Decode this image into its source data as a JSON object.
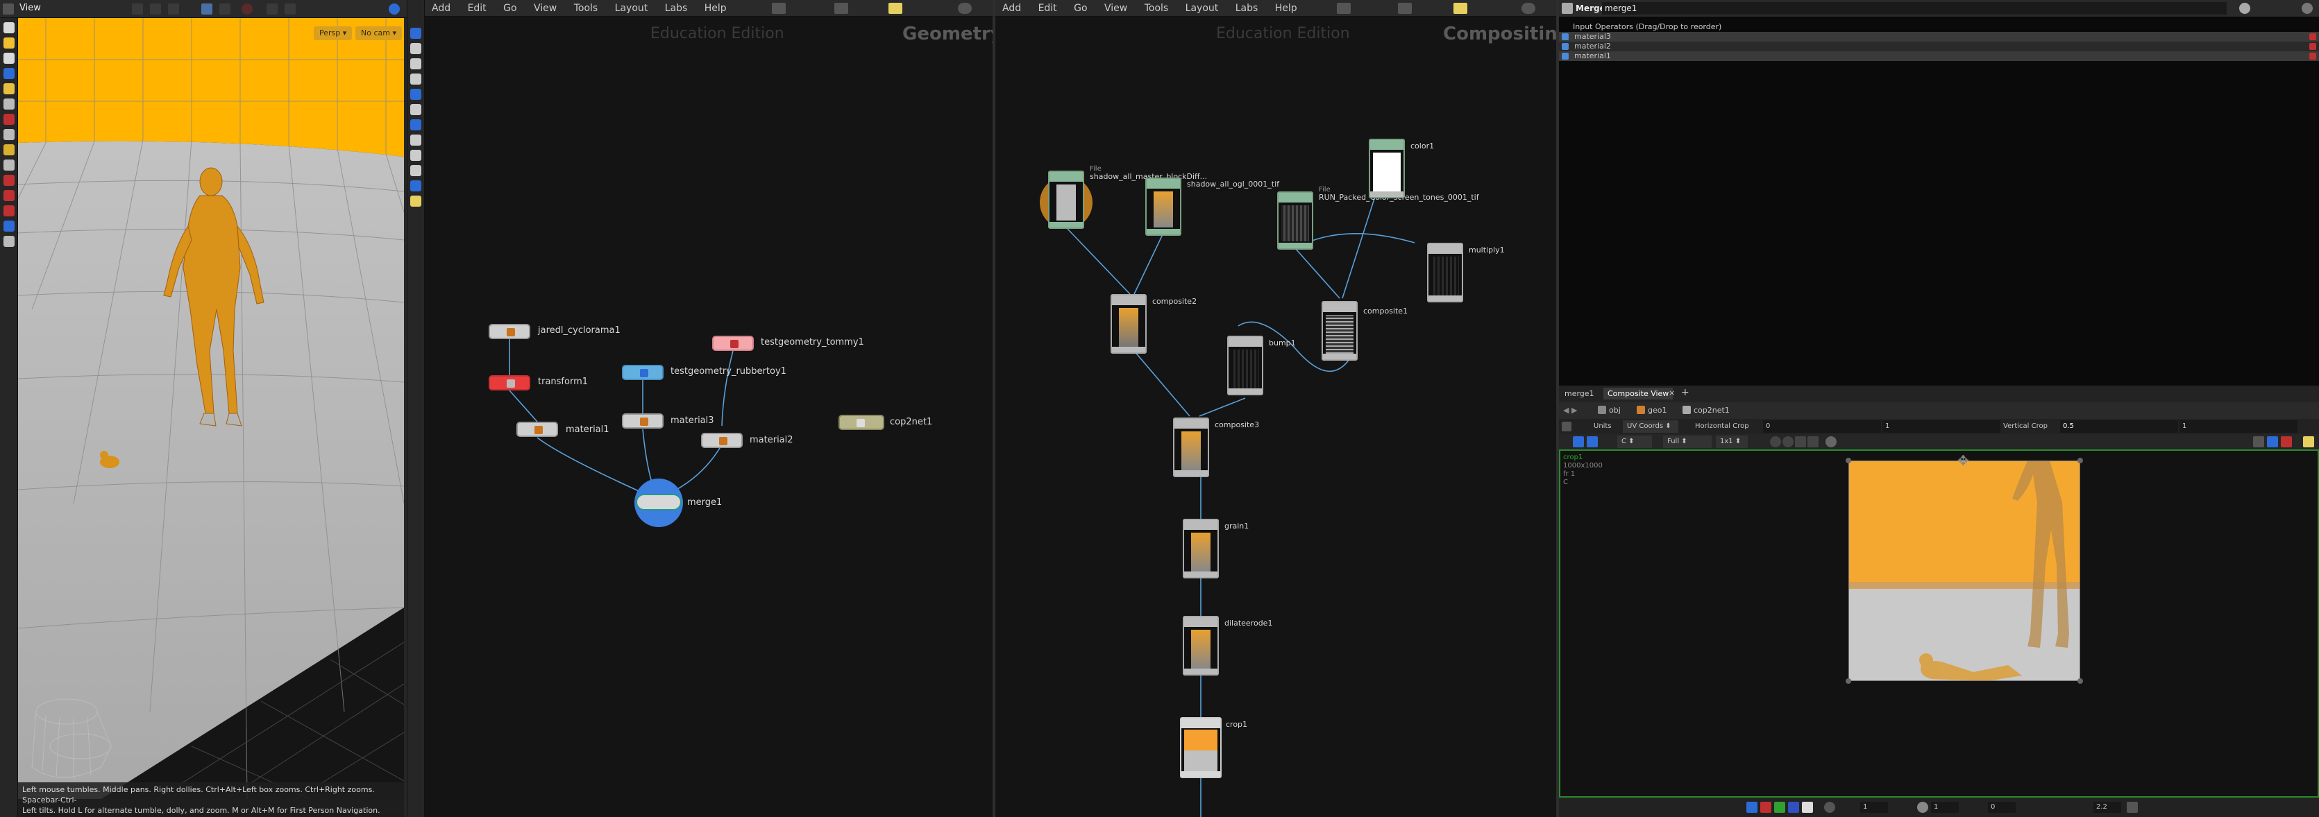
{
  "viewport": {
    "title": "View",
    "persp_label": "Persp",
    "cam_label": "No cam",
    "status_line1": "Left mouse tumbles. Middle pans. Right dollies. Ctrl+Alt+Left box zooms. Ctrl+Right zooms. Spacebar-Ctrl-",
    "status_line2": "Left tilts. Hold L for alternate tumble, dolly, and zoom.    M or Alt+M for First Person Navigation."
  },
  "geo_network": {
    "menu": [
      "Add",
      "Edit",
      "Go",
      "View",
      "Tools",
      "Layout",
      "Labs",
      "Help"
    ],
    "watermark": "Education Edition",
    "context": "Geometry",
    "nodes": {
      "cyclorama": "jaredl_cyclorama1",
      "transform": "transform1",
      "material1": "material1",
      "rubbertoy": "testgeometry_rubbertoy1",
      "material3": "material3",
      "tommy": "testgeometry_tommy1",
      "material2": "material2",
      "merge": "merge1",
      "cop2net": "cop2net1"
    }
  },
  "cop_network": {
    "menu": [
      "Add",
      "Edit",
      "Go",
      "View",
      "Tools",
      "Layout",
      "Labs",
      "Help"
    ],
    "watermark": "Education Edition",
    "context": "Compositing",
    "nodes": {
      "file1": "shadow_all_master_blockDiff...",
      "file1_tag": "File",
      "file2": "shadow_all_ogl_0001_tif",
      "file3": "RUN_Packed_Color_screen_tones_0001_tif",
      "file3_tag": "File",
      "color1": "color1",
      "multiply1": "multiply1",
      "composite2": "composite2",
      "composite1": "composite1",
      "bump1": "bump1",
      "composite3": "composite3",
      "grain1": "grain1",
      "dilateerode1": "dilateerode1",
      "crop1": "crop1"
    }
  },
  "params": {
    "type": "Merge",
    "name": "merge1",
    "list_header": "Input Operators (Drag/Drop to reorder)",
    "inputs": [
      "material3",
      "material2",
      "material1"
    ]
  },
  "composite_view": {
    "tabs": [
      "merge1",
      "Composite View"
    ],
    "path": [
      "obj",
      "geo1",
      "cop2net1"
    ],
    "units_label": "Units",
    "units_value": "UV Coords",
    "hcrop_label": "Horizontal Crop",
    "hcrop_a": "0",
    "hcrop_b": "1",
    "vcrop_label": "Vertical Crop",
    "vcrop_a": "0.5",
    "vcrop_b": "1",
    "plane": "C",
    "res": "Full",
    "size": "1x1",
    "info_name": "crop1",
    "info_res": "1000x1000",
    "info_frame": "fr 1",
    "info_plane": "C",
    "bottom_frame": "1",
    "bottom_frame2": "1",
    "bottom_val": "0",
    "bottom_gamma": "2.2"
  },
  "colors": {
    "wall": "#ffb400",
    "floor": "#c9c9c9",
    "figure": "#d9921a",
    "accent": "#2d6bd6"
  }
}
